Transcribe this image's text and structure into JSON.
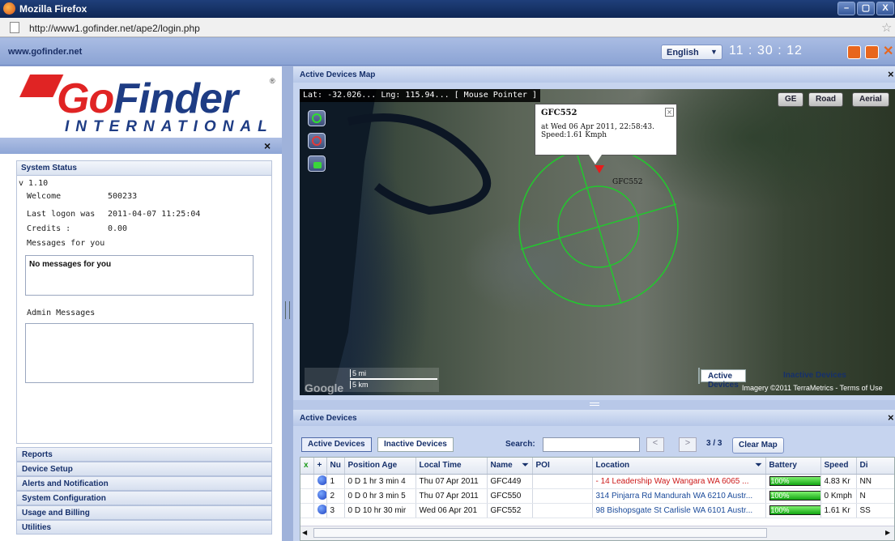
{
  "browser": {
    "window_title": "Mozilla Firefox",
    "url": "http://www1.gofinder.net/ape2/login.php",
    "controls": [
      "–",
      "▢",
      "X"
    ]
  },
  "header": {
    "site": "www.gofinder.net",
    "language": "English",
    "clock": "11 : 30 : 12",
    "icons": [
      "window-icon",
      "expand-icon",
      "close-icon"
    ]
  },
  "logo": {
    "brand_part1": "Go",
    "brand_part2": "Finder",
    "registered": "®",
    "subtitle": "INTERNATIONAL"
  },
  "left_panel": {
    "close": "×",
    "system_status": {
      "title": "System Status",
      "version": "v 1.10",
      "welcome_label": "Welcome",
      "welcome_value": "500233",
      "last_logon_label": "Last logon was",
      "last_logon_value": "2011-04-07 11:25:04",
      "credits_label": "Credits :",
      "credits_value": "0.00",
      "messages_label": "Messages for you",
      "messages_text": "No messages for you",
      "admin_label": "Admin Messages"
    },
    "nav": [
      "Reports",
      "Device Setup",
      "Alerts and Notification",
      "System Configuration",
      "Usage and Billing",
      "Utilities"
    ]
  },
  "map_panel": {
    "title": "Active Devices Map",
    "close": "×",
    "coords": "Lat: -32.026...     Lng: 115.94...     [ Mouse Pointer ]",
    "view_buttons": [
      "GE",
      "Road",
      "Aerial"
    ],
    "popup": {
      "device": "GFC552",
      "line1": "at Wed 06 Apr 2011, 22:58:43.",
      "line2": "Speed:1.61 Kmph",
      "close": "×"
    },
    "marker_label": "GFC552",
    "scale_mi": "5 mi",
    "scale_km": "5 km",
    "tabs": [
      "Active Devices",
      "Inactive Devices"
    ],
    "copyright": "Imagery ©2011  TerraMetrics - Terms of Use",
    "watermark": "Google"
  },
  "devices_panel": {
    "title": "Active Devices",
    "close": "×",
    "tabs": [
      "Active Devices",
      "Inactive Devices"
    ],
    "search_label": "Search:",
    "search_value": "",
    "prev": "<",
    "next": ">",
    "page_info": "3 / 3",
    "clear_map": "Clear Map",
    "columns": [
      "x",
      "+",
      "Nu",
      "Position Age",
      "Local Time",
      "Name",
      "POI",
      "Location",
      "Battery",
      "Speed",
      "Di"
    ],
    "rows": [
      {
        "num": "1",
        "age": "0 D 1 hr 3 min 4",
        "time": "Thu 07 Apr 2011",
        "name": "GFC449",
        "poi": "",
        "location": "- 14 Leadership Way Wangara WA 6065 ...",
        "battery": "100%",
        "speed": "4.83 Kr",
        "dir": "NN",
        "loc_color": "#cc1a1a"
      },
      {
        "num": "2",
        "age": "0 D 0 hr 3 min 5",
        "time": "Thu 07 Apr 2011",
        "name": "GFC550",
        "poi": "",
        "location": "314 Pinjarra Rd Mandurah WA 6210 Austr...",
        "battery": "100%",
        "speed": "0 Kmph",
        "dir": "N",
        "loc_color": "#1a4a9a"
      },
      {
        "num": "3",
        "age": "0 D 10 hr 30 mir",
        "time": "Wed 06 Apr 201",
        "name": "GFC552",
        "poi": "",
        "location": "98 Bishopsgate St Carlisle WA 6101 Austr...",
        "battery": "100%",
        "speed": "1.61 Kr",
        "dir": "SS",
        "loc_color": "#1a4a9a"
      }
    ]
  }
}
